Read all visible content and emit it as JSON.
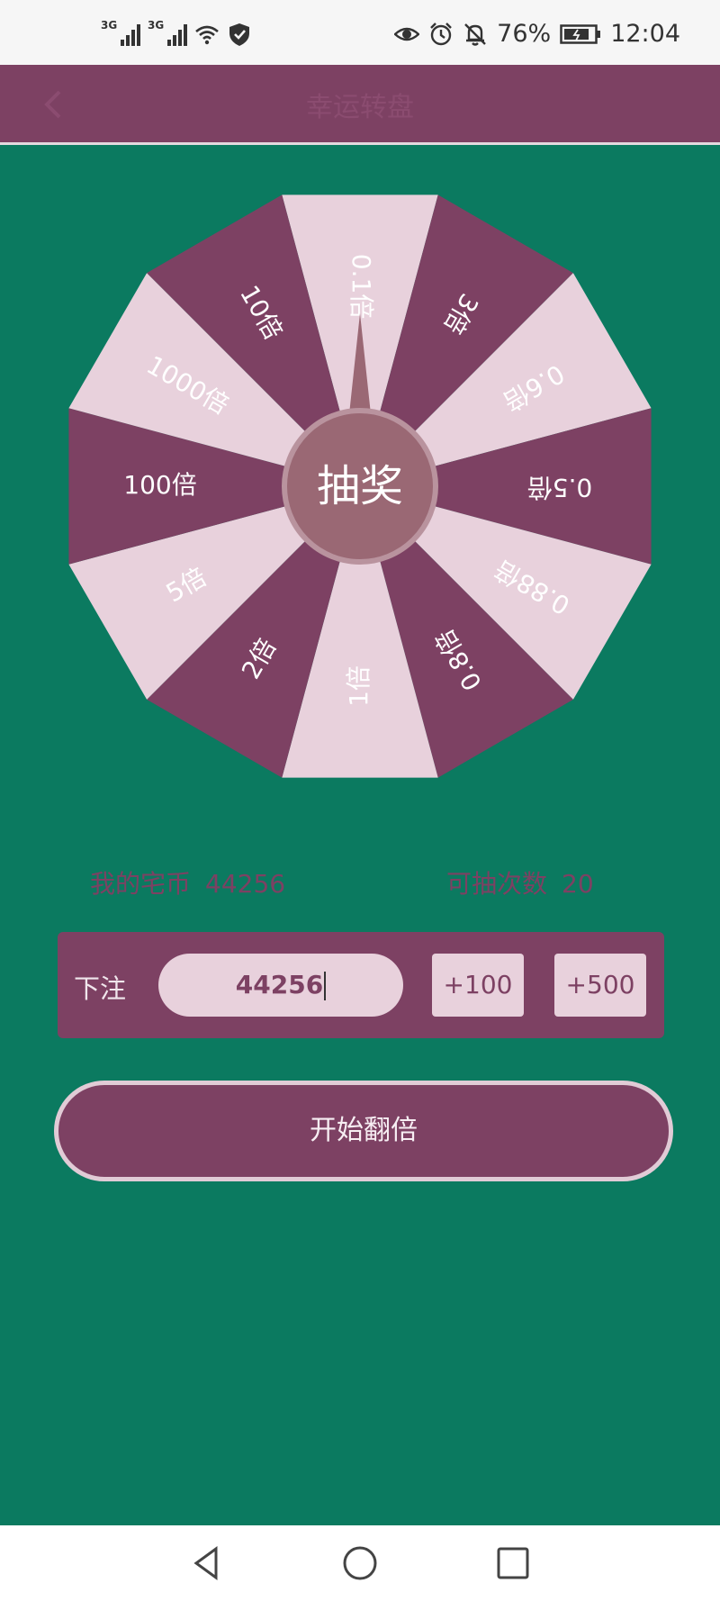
{
  "status_bar": {
    "net1": "3G",
    "net2": "3G",
    "battery": "76%",
    "time": "12:04",
    "icons": [
      "signal-icon",
      "signal-icon",
      "wifi-icon",
      "shield-icon",
      "eye-icon",
      "alarm-icon",
      "bell-off-icon",
      "battery-icon"
    ]
  },
  "header": {
    "title": "幸运转盘",
    "back_icon": "back-arrow-icon"
  },
  "wheel": {
    "center_label": "抽奖",
    "segments": [
      "0.1倍",
      "3倍",
      "0.6倍",
      "0.5倍",
      "0.88倍",
      "0.8倍",
      "1倍",
      "2倍",
      "5倍",
      "100倍",
      "1000倍",
      "10倍"
    ],
    "colors": {
      "dark": "#7d4163",
      "light": "#e8d1dc",
      "hub": "#9a6874",
      "hub_ring": "#b9939e"
    }
  },
  "info": {
    "coins_label": "我的宅币",
    "coins_value": "44256",
    "draws_label": "可抽次数",
    "draws_value": "20"
  },
  "bet": {
    "label": "下注",
    "value": "44256",
    "add_100": "+100",
    "add_500": "+500"
  },
  "start_button": {
    "label": "开始翻倍"
  },
  "nav": {
    "icons": [
      "nav-back-icon",
      "nav-home-icon",
      "nav-recents-icon"
    ]
  },
  "colors": {
    "background": "#0b7a60",
    "primary": "#7d4163",
    "light": "#e8d1dc"
  }
}
